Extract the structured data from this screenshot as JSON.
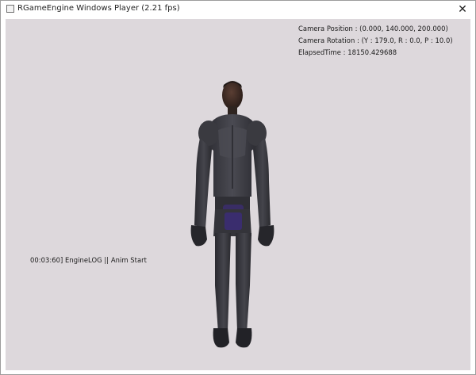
{
  "window": {
    "title": "RGameEngine Windows Player  (2.21 fps)",
    "close_glyph": "✕"
  },
  "hud": {
    "camera_position": "Camera Position : (0.000, 140.000, 200.000)",
    "camera_rotation": "Camera Rotation : (Y : 179.0, R : 0.0, P : 10.0)",
    "elapsed_time": "ElapsedTime : 18150.429688"
  },
  "log": {
    "line": "00:03:60] EngineLOG ||  Anim Start"
  },
  "colors": {
    "viewport_bg": "#ddd8dc",
    "armor": "#3e3e44",
    "skin": "#3b2b26"
  },
  "icons": {
    "app": "app-icon",
    "close": "close-icon"
  }
}
